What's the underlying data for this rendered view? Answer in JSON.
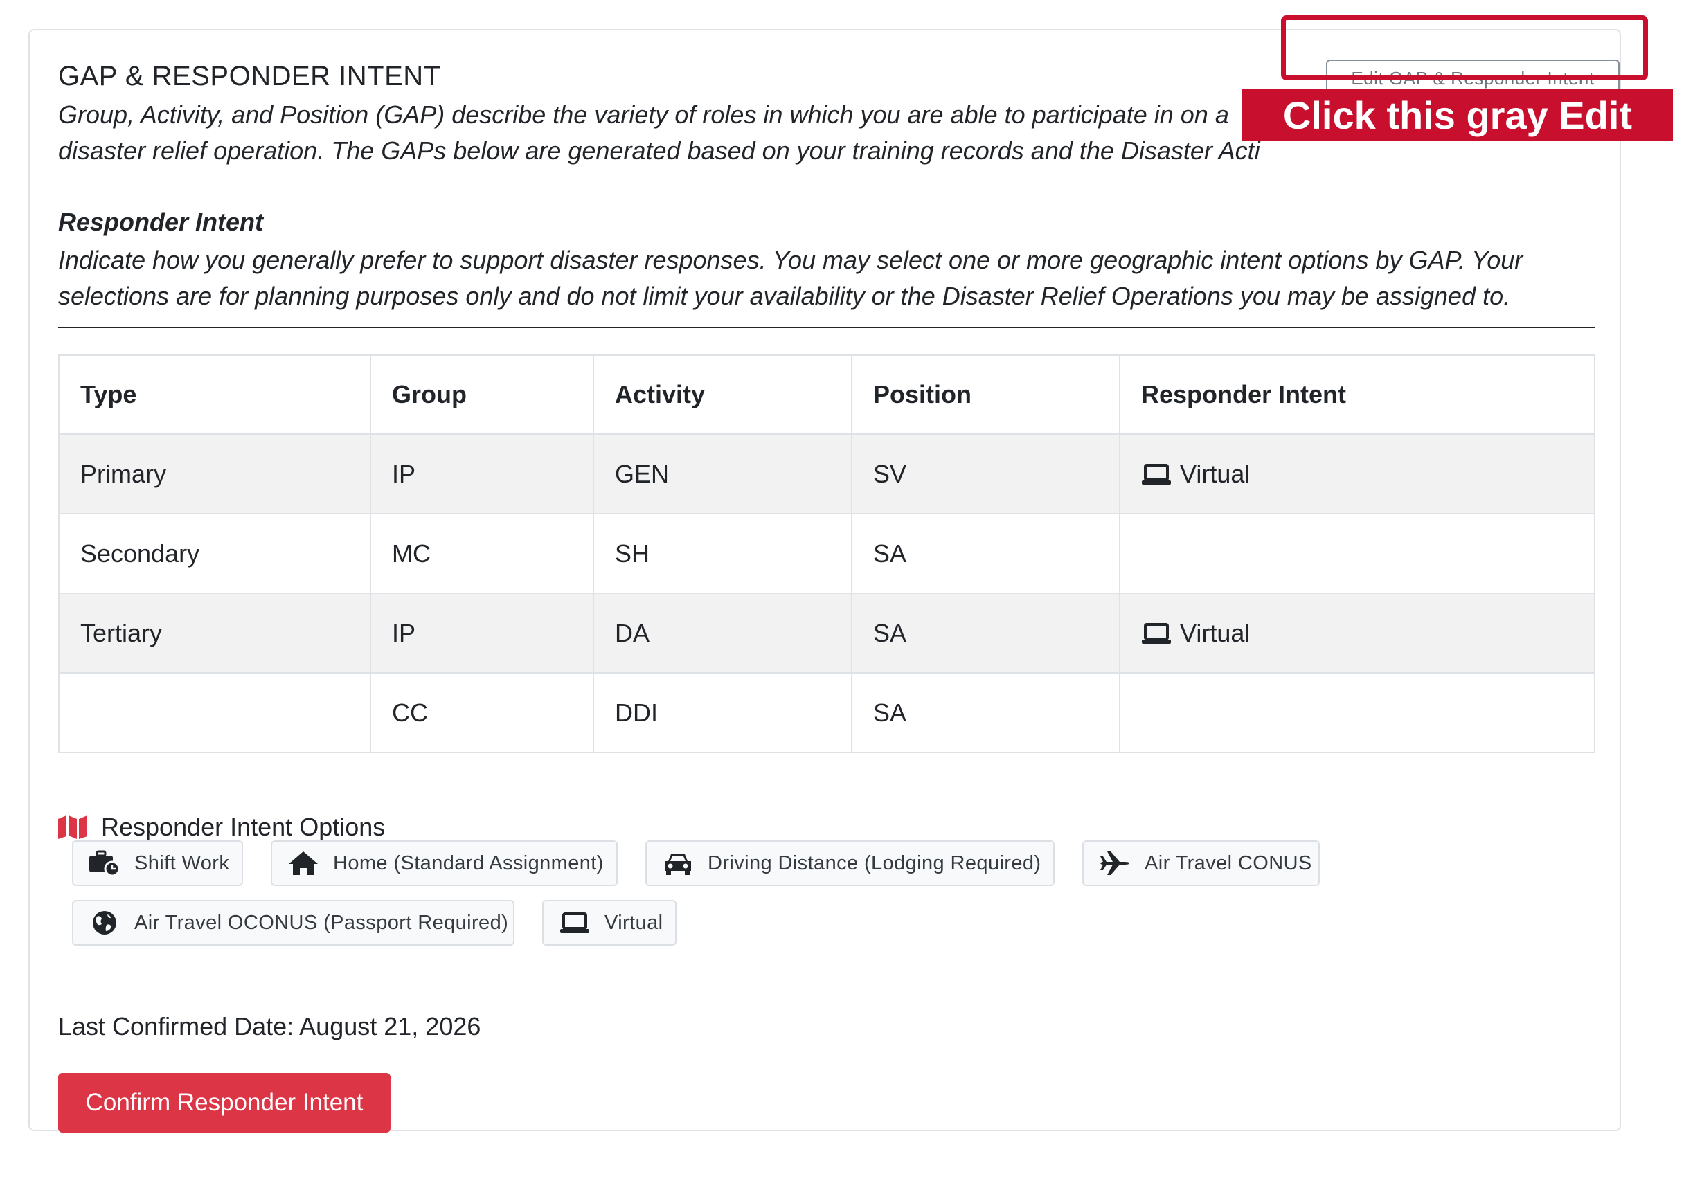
{
  "card": {
    "title": "GAP & RESPONDER INTENT",
    "description": "Group, Activity, and Position (GAP) describe the variety of roles in which you are able to participate in on a disaster relief operation. The GAPs below are generated based on your training records and the Disaster Acti",
    "edit_button_label": "Edit GAP & Responder Intent",
    "annotation_label": "Click this gray Edit"
  },
  "responder_intent": {
    "heading": "Responder Intent",
    "description": "Indicate how you generally prefer to support disaster responses. You may select one or more geographic intent options by GAP. Your selections are for planning purposes only and do not limit your availability or the Disaster Relief Operations you may be assigned to."
  },
  "table": {
    "headers": [
      "Type",
      "Group",
      "Activity",
      "Position",
      "Responder Intent"
    ],
    "rows": [
      {
        "type": "Primary",
        "group": "IP",
        "activity": "GEN",
        "position": "SV",
        "intent": "Virtual",
        "intent_icon": "laptop-icon"
      },
      {
        "type": "Secondary",
        "group": "MC",
        "activity": "SH",
        "position": "SA",
        "intent": "",
        "intent_icon": ""
      },
      {
        "type": "Tertiary",
        "group": "IP",
        "activity": "DA",
        "position": "SA",
        "intent": "Virtual",
        "intent_icon": "laptop-icon"
      },
      {
        "type": "",
        "group": "CC",
        "activity": "DDI",
        "position": "SA",
        "intent": "",
        "intent_icon": ""
      }
    ]
  },
  "options": {
    "heading": "Responder Intent Options",
    "heading_icon": "map-icon",
    "items": [
      {
        "label": "Shift Work",
        "icon": "briefcase-clock-icon"
      },
      {
        "label": "Home (Standard Assignment)",
        "icon": "home-icon"
      },
      {
        "label": "Driving Distance (Lodging Required)",
        "icon": "car-icon"
      },
      {
        "label": "Air Travel CONUS",
        "icon": "plane-icon"
      },
      {
        "label": "Air Travel OCONUS (Passport Required)",
        "icon": "globe-icon"
      },
      {
        "label": "Virtual",
        "icon": "laptop-icon"
      }
    ]
  },
  "last_confirmed": "Last Confirmed Date: August 21, 2026",
  "confirm_button_label": "Confirm Responder Intent",
  "colors": {
    "primary_red": "#dc3545",
    "annotation_red": "#c8102e",
    "map_icon_red": "#dc3545",
    "striped_row": "#f2f2f2"
  }
}
